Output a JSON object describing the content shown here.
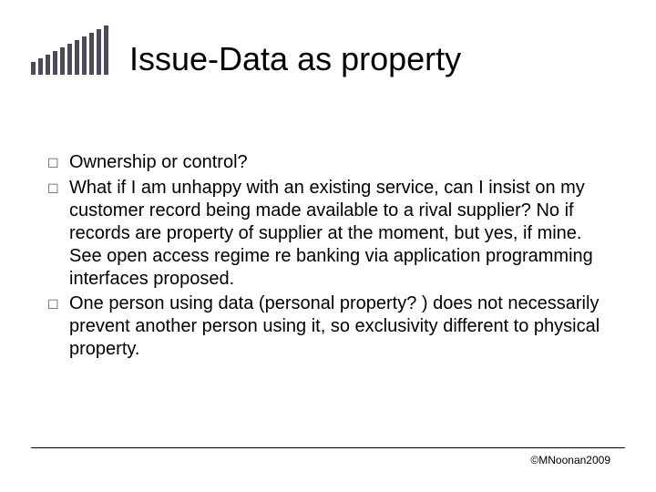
{
  "title": "Issue-Data as property",
  "bullets": [
    "Ownership or control?",
    "What if I am unhappy with an existing service, can I insist on my customer record being made available to a rival supplier? No if records are property of supplier at the moment, but yes, if mine. See open access regime re banking via application programming interfaces proposed.",
    "One person using data (personal property? ) does not necessarily prevent another person using it, so exclusivity different to physical property."
  ],
  "footer": "©MNoonan2009"
}
